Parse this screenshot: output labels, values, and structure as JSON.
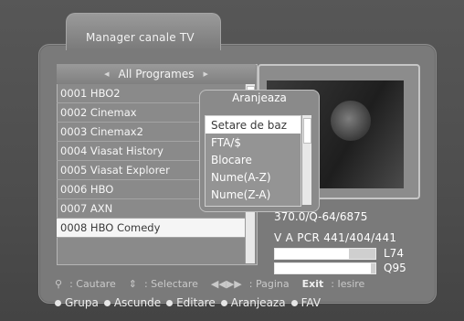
{
  "window": {
    "title": "Manager canale TV"
  },
  "group": {
    "label": "All Programes",
    "left_arrow": "◀",
    "right_arrow": "▶"
  },
  "channels": [
    {
      "label": "0001 HBO2",
      "fav": false,
      "selected": false
    },
    {
      "label": "0002 Cinemax",
      "fav": false,
      "selected": false
    },
    {
      "label": "0003 Cinemax2",
      "fav": true,
      "selected": false
    },
    {
      "label": "0004 Viasat History",
      "fav": true,
      "selected": false
    },
    {
      "label": "0005 Viasat Explorer",
      "fav": true,
      "selected": false
    },
    {
      "label": "0006 HBO",
      "fav": false,
      "selected": false
    },
    {
      "label": "0007 AXN",
      "fav": false,
      "selected": false
    },
    {
      "label": "0008 HBO Comedy",
      "fav": false,
      "selected": true
    }
  ],
  "sort_dialog": {
    "title": "Aranjeaza",
    "options": [
      "Setare de baz",
      "FTA/$",
      "Blocare",
      "Nume(A-Z)",
      "Nume(Z-A)"
    ],
    "selected_index": 0
  },
  "signal_info": {
    "freq_line": "370.0/Q-64/6875",
    "pid_line": "V A PCR 441/404/441",
    "level_label": "L74",
    "quality_label": "Q95",
    "level": 0.74,
    "quality": 0.95
  },
  "hints": {
    "search_icon": "magnifier-icon",
    "search": ": Cautare",
    "select_icon": "updown-icon",
    "select": ": Selectare",
    "page_icon": "page-arrows-icon",
    "page": ": Pagina",
    "exit_key": "Exit",
    "exit": ": Iesire"
  },
  "legend": [
    {
      "label": "Grupa",
      "color": "#e6e6e6"
    },
    {
      "label": "Ascunde",
      "color": "#e6e6e6"
    },
    {
      "label": "Editare",
      "color": "#e6e6e6"
    },
    {
      "label": "Aranjeaza",
      "color": "#e6e6e6"
    },
    {
      "label": "FAV",
      "color": "#e6e6e6"
    }
  ]
}
